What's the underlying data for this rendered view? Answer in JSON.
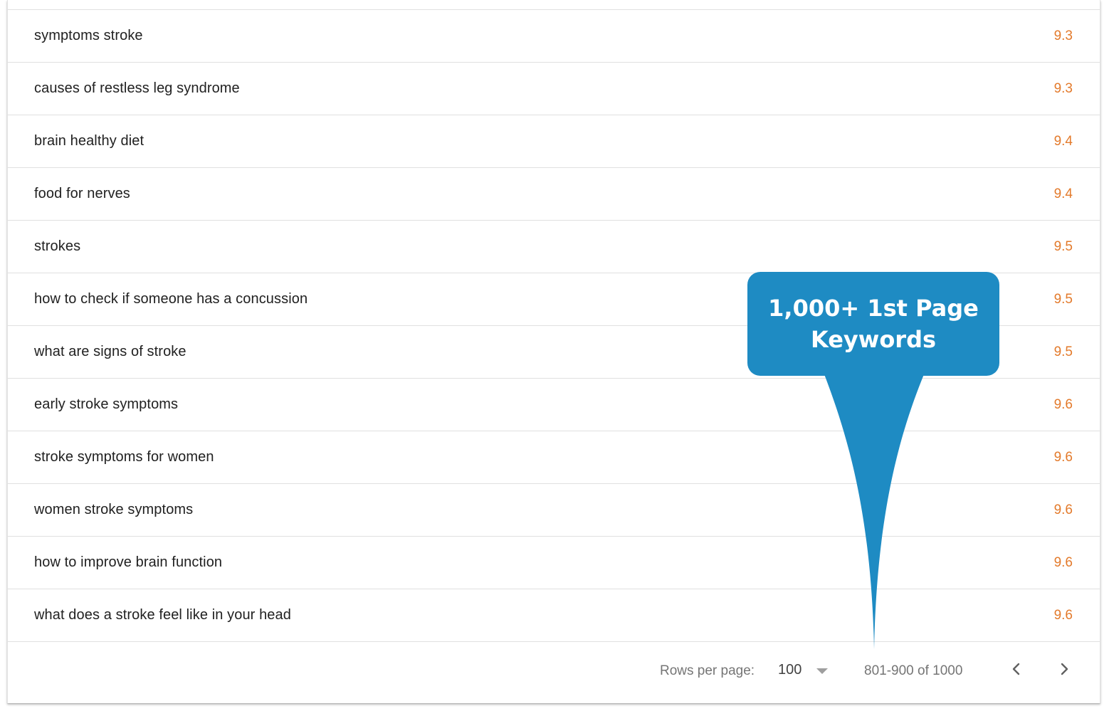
{
  "table": {
    "rows": [
      {
        "keyword": "symptoms stroke",
        "position": "9.3"
      },
      {
        "keyword": "causes of restless leg syndrome",
        "position": "9.3"
      },
      {
        "keyword": "brain healthy diet",
        "position": "9.4"
      },
      {
        "keyword": "food for nerves",
        "position": "9.4"
      },
      {
        "keyword": "strokes",
        "position": "9.5"
      },
      {
        "keyword": "how to check if someone has a concussion",
        "position": "9.5"
      },
      {
        "keyword": "what are signs of stroke",
        "position": "9.5"
      },
      {
        "keyword": "early stroke symptoms",
        "position": "9.6"
      },
      {
        "keyword": "stroke symptoms for women",
        "position": "9.6"
      },
      {
        "keyword": "women stroke symptoms",
        "position": "9.6"
      },
      {
        "keyword": "how to improve brain function",
        "position": "9.6"
      },
      {
        "keyword": "what does a stroke feel like in your head",
        "position": "9.6"
      }
    ]
  },
  "pagination": {
    "rows_per_page_label": "Rows per page:",
    "rows_per_page_value": "100",
    "range_text": "801-900 of 1000",
    "prev_icon": "chevron-left-icon",
    "next_icon": "chevron-right-icon"
  },
  "callout": {
    "text": "1,000+ 1st Page Keywords",
    "color": "#1e8bc3"
  },
  "colors": {
    "position_value": "#e37a2b",
    "keyword_text": "#212121",
    "divider": "#e0e0e0"
  }
}
